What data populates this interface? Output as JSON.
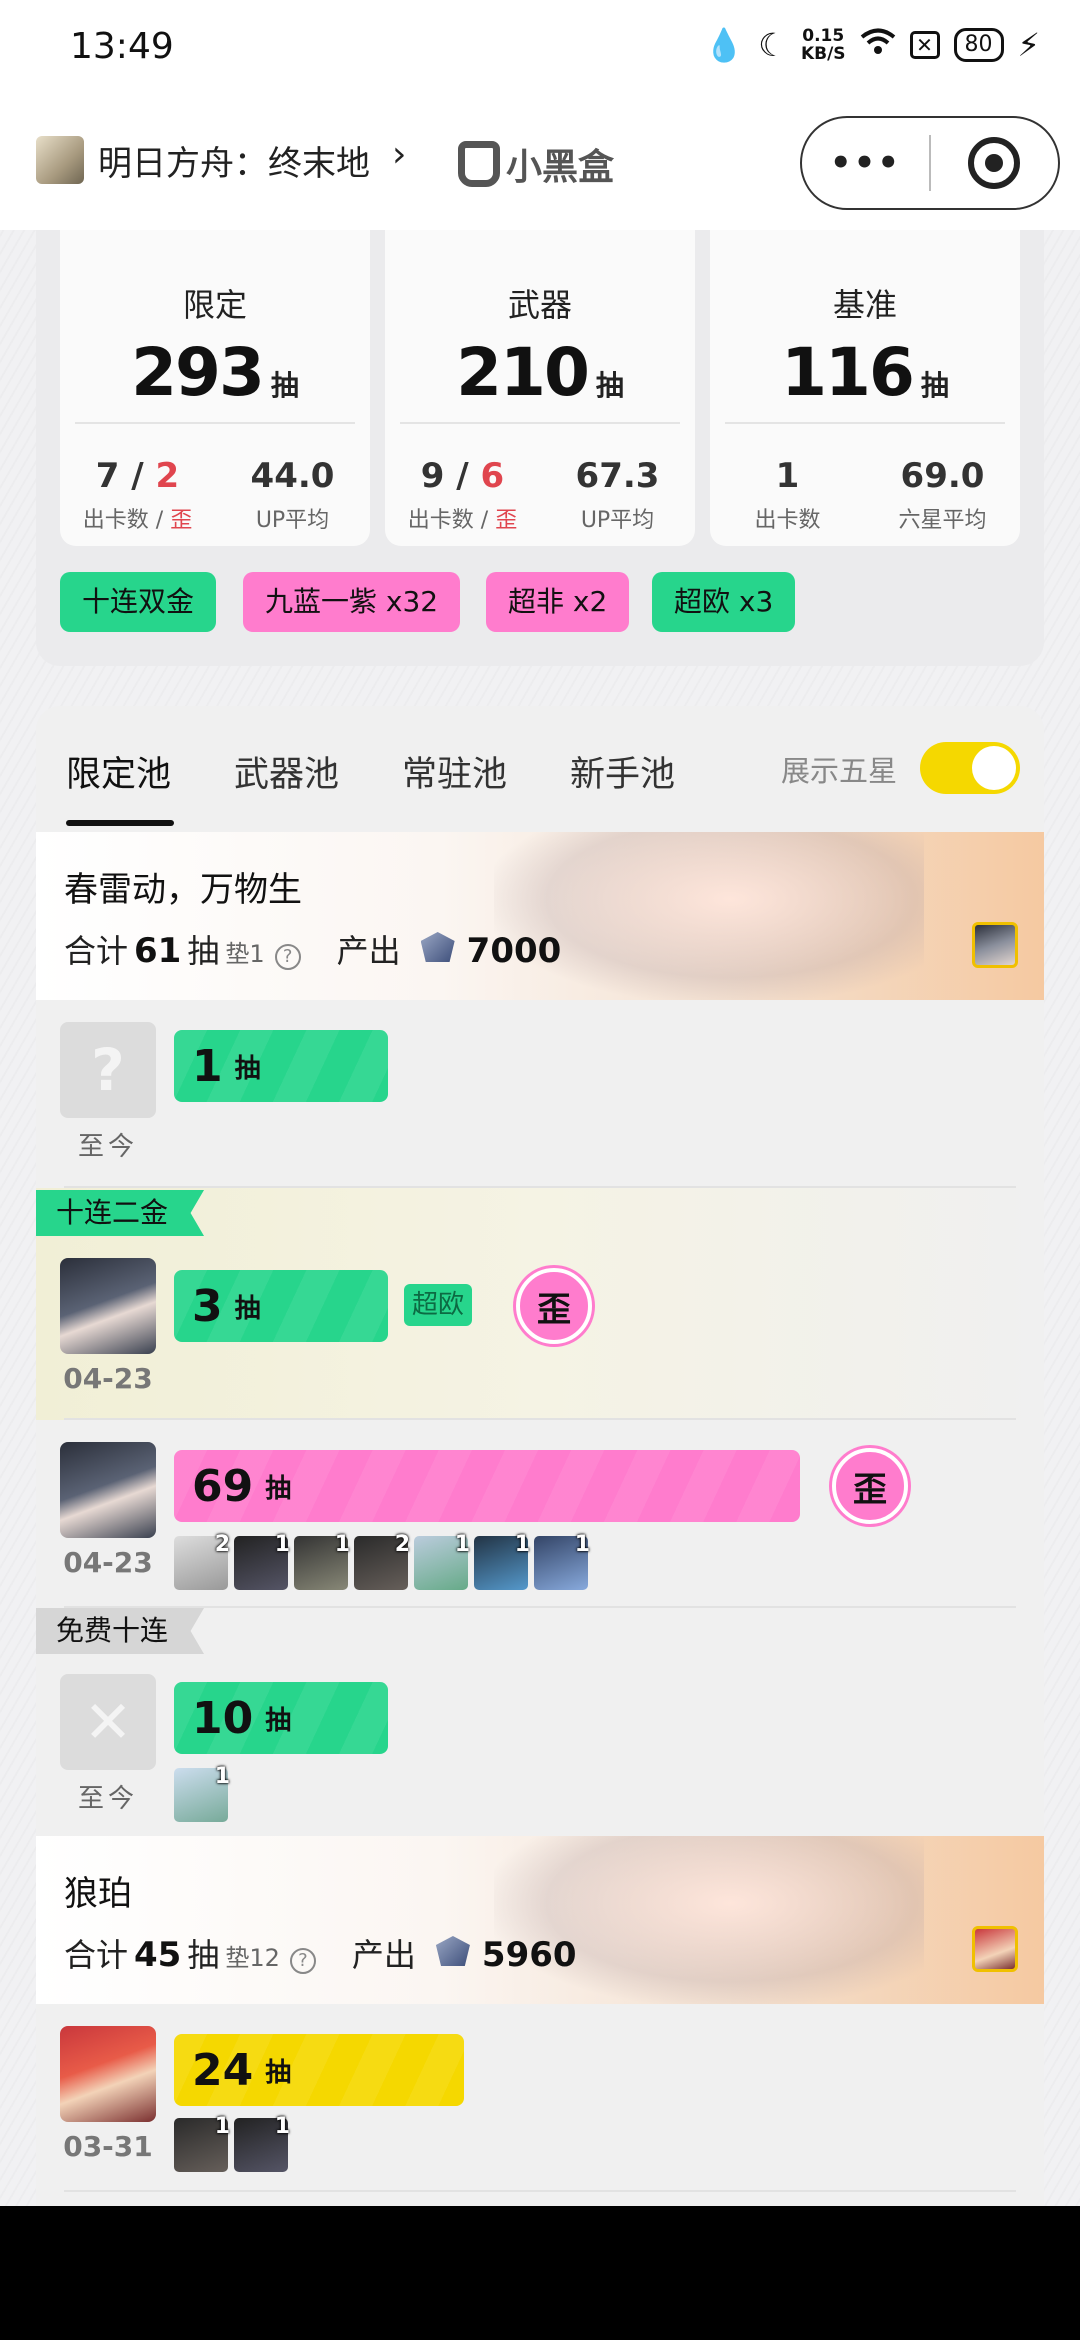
{
  "status": {
    "time": "13:49",
    "net_speed_value": "0.15",
    "net_speed_unit": "KB/S",
    "battery": "80",
    "icons": [
      "water-drop-icon",
      "moon-icon",
      "wifi-icon",
      "x-box-icon",
      "battery-icon",
      "charging-icon"
    ]
  },
  "nav": {
    "app_title": "明日方舟：终末地",
    "chevron": "›",
    "brand": "小黑盒",
    "more": "•••"
  },
  "summary": {
    "boxes": [
      {
        "name": "限定",
        "total": "293",
        "unit": "抽",
        "left_value": "7",
        "left_slash": " / ",
        "left_red": "2",
        "left_label": "出卡数 / ",
        "left_label_red": "歪",
        "right_value": "44.0",
        "right_label": "UP平均"
      },
      {
        "name": "武器",
        "total": "210",
        "unit": "抽",
        "left_value": "9",
        "left_slash": " / ",
        "left_red": "6",
        "left_label": "出卡数 / ",
        "left_label_red": "歪",
        "right_value": "67.3",
        "right_label": "UP平均"
      },
      {
        "name": "基准",
        "total": "116",
        "unit": "抽",
        "left_value": "1",
        "left_label": "出卡数",
        "right_value": "69.0",
        "right_label": "六星平均"
      }
    ],
    "tags": [
      {
        "label": "十连双金",
        "color": "#27d58c"
      },
      {
        "label": "九蓝一紫 x32",
        "color": "#ff7ccd"
      },
      {
        "label": "超非 x2",
        "color": "#ff7ccd"
      },
      {
        "label": "超欧 x3",
        "color": "#27d58c"
      }
    ]
  },
  "pool": {
    "tabs": [
      "限定池",
      "武器池",
      "常驻池",
      "新手池"
    ],
    "active_tab": "限定池",
    "toggle_label": "展示五星",
    "toggle_on": true,
    "banners": [
      {
        "title": "春雷动，万物生",
        "total_prefix": "合计",
        "total": "61",
        "total_unit": "抽",
        "pity": "垫1",
        "help": "?",
        "output_label": "产出",
        "output": "7000"
      },
      {
        "title": "狼珀",
        "total_prefix": "合计",
        "total": "45",
        "total_unit": "抽",
        "pity": "垫12",
        "help": "?",
        "output_label": "产出",
        "output": "5960"
      }
    ],
    "rows": [
      {
        "pulls": "1",
        "unit": "抽",
        "date": "至今",
        "placeholder": "?",
        "color": "#27d58c"
      },
      {
        "ribbon": "十连二金",
        "pulls": "3",
        "unit": "抽",
        "date": "04-23",
        "chip": "超欧",
        "badge": "歪",
        "color": "#27d58c"
      },
      {
        "pulls": "69",
        "unit": "抽",
        "date": "04-23",
        "badge": "歪",
        "color": "#ff7ccd",
        "thumb_counts": [
          "2",
          "1",
          "1",
          "2",
          "1",
          "1",
          "1"
        ]
      },
      {
        "ribbon": "免费十连",
        "pulls": "10",
        "unit": "抽",
        "date": "至今",
        "placeholder": "✕",
        "color": "#27d58c",
        "thumb_counts": [
          "1"
        ]
      },
      {
        "pulls": "24",
        "unit": "抽",
        "date": "03-31",
        "color": "#f5d800",
        "thumb_counts": [
          "1",
          "1"
        ]
      }
    ]
  }
}
